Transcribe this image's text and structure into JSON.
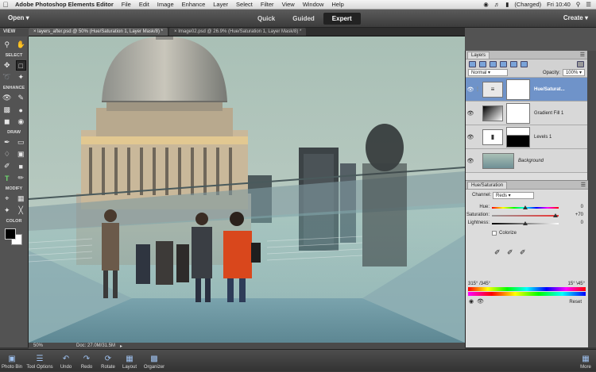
{
  "menubar": {
    "apple": "",
    "app_name": "Adobe Photoshop Elements Editor",
    "items": [
      "File",
      "Edit",
      "Image",
      "Enhance",
      "Layer",
      "Select",
      "Filter",
      "View",
      "Window",
      "Help"
    ],
    "battery": "(Charged)",
    "clock": "Fri 10:40"
  },
  "modebar": {
    "open": "Open",
    "modes": [
      "Quick",
      "Guided",
      "Expert"
    ],
    "active_mode": "Expert",
    "create": "Create"
  },
  "view_label": "VIEW",
  "tabs": [
    {
      "label": "layers_after.psd @ 50% (Hue/Saturation 1, Layer Mask/8) *",
      "active": true
    },
    {
      "label": "Image02.psd @ 26.9% (Hue/Saturation 1, Layer Mask/8) *",
      "active": false
    }
  ],
  "toolbox": {
    "sections": [
      "SELECT",
      "ENHANCE",
      "DRAW",
      "MODIFY",
      "COLOR"
    ]
  },
  "status": {
    "zoom": "50%",
    "doc": "Doc: 27.0M/31.5M"
  },
  "layers_panel": {
    "tab": "Layers",
    "blend_mode": "Normal",
    "opacity_label": "Opacity:",
    "opacity_value": "100%",
    "layers": [
      {
        "name": "Hue/Saturat...",
        "selected": true
      },
      {
        "name": "Gradient Fill 1",
        "selected": false
      },
      {
        "name": "Levels 1",
        "selected": false
      },
      {
        "name": "Background",
        "selected": false
      }
    ]
  },
  "hue_sat": {
    "tab": "Hue/Saturation",
    "channel_label": "Channel:",
    "channel_value": "Reds",
    "hue_label": "Hue:",
    "hue_value": "0",
    "saturation_label": "Saturation:",
    "saturation_value": "+70",
    "lightness_label": "Lightness:",
    "lightness_value": "0",
    "colorize_label": "Colorize",
    "range_left": "315° /345°",
    "range_right": "15° \\45°",
    "reset": "Reset"
  },
  "bottombar": {
    "items": [
      "Photo Bin",
      "Tool Options",
      "Undo",
      "Redo",
      "Rotate",
      "Layout",
      "Organizer"
    ],
    "more": "More"
  }
}
